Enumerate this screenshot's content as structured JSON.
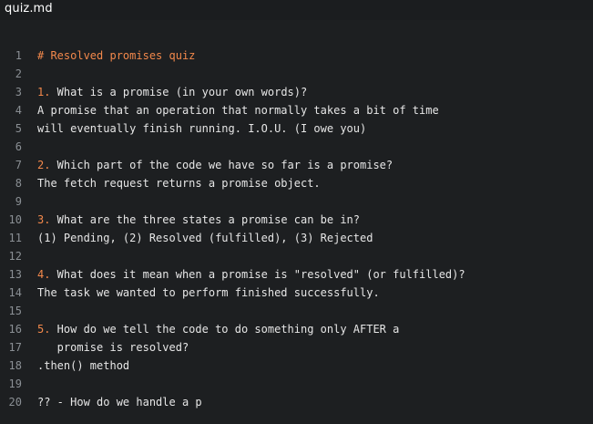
{
  "window": {
    "title": "quiz.md"
  },
  "colors": {
    "background": "#1d1f21",
    "text": "#e6e6e6",
    "accent_orange": "#f2884b",
    "line_number": "#8a8f94"
  },
  "editor": {
    "lines": [
      {
        "num": "1",
        "prefix": "# Resolved promises quiz",
        "text": ""
      },
      {
        "num": "2",
        "prefix": "",
        "text": ""
      },
      {
        "num": "3",
        "prefix": "1.",
        "text": " What is a promise (in your own words)?"
      },
      {
        "num": "4",
        "prefix": "",
        "text": "A promise that an operation that normally takes a bit of time"
      },
      {
        "num": "5",
        "prefix": "",
        "text": "will eventually finish running. I.O.U. (I owe you)"
      },
      {
        "num": "6",
        "prefix": "",
        "text": ""
      },
      {
        "num": "7",
        "prefix": "2.",
        "text": " Which part of the code we have so far is a promise?"
      },
      {
        "num": "8",
        "prefix": "",
        "text": "The fetch request returns a promise object."
      },
      {
        "num": "9",
        "prefix": "",
        "text": ""
      },
      {
        "num": "10",
        "prefix": "3.",
        "text": " What are the three states a promise can be in?"
      },
      {
        "num": "11",
        "prefix": "",
        "text": "(1) Pending, (2) Resolved (fulfilled), (3) Rejected"
      },
      {
        "num": "12",
        "prefix": "",
        "text": ""
      },
      {
        "num": "13",
        "prefix": "4.",
        "text": " What does it mean when a promise is \"resolved\" (or fulfilled)?"
      },
      {
        "num": "14",
        "prefix": "",
        "text": "The task we wanted to perform finished successfully."
      },
      {
        "num": "15",
        "prefix": "",
        "text": ""
      },
      {
        "num": "16",
        "prefix": "5.",
        "text": " How do we tell the code to do something only AFTER a"
      },
      {
        "num": "17",
        "prefix": "",
        "text": "   promise is resolved?"
      },
      {
        "num": "18",
        "prefix": "",
        "text": ".then() method"
      },
      {
        "num": "19",
        "prefix": "",
        "text": ""
      },
      {
        "num": "20",
        "prefix": "",
        "text": "?? - How do we handle a p"
      }
    ]
  }
}
